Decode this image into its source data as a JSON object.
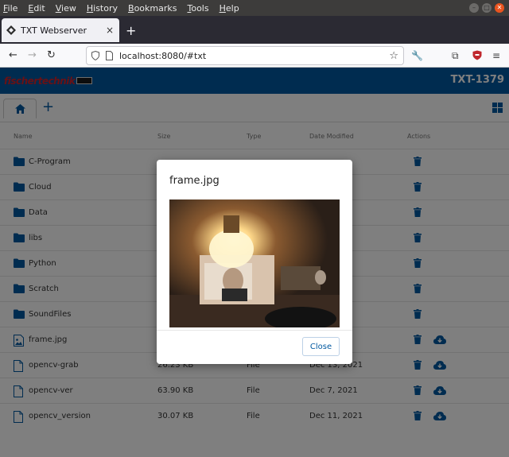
{
  "menu": [
    "File",
    "Edit",
    "View",
    "History",
    "Bookmarks",
    "Tools",
    "Help"
  ],
  "menu_mnemonics": [
    "F",
    "E",
    "V",
    "H",
    "B",
    "T",
    "H"
  ],
  "window_controls": {
    "minimize_icon": "minus-icon",
    "maximize_icon": "square-icon",
    "close_icon": "x-icon"
  },
  "tab": {
    "title": "TXT Webserver",
    "close_label": "×",
    "new_tab_label": "+"
  },
  "nav": {
    "url": "localhost:8080/#txt"
  },
  "app": {
    "logo_text": "fischertechnik",
    "device_name": "TXT-1379",
    "add_label": "+"
  },
  "table": {
    "headers": {
      "name": "Name",
      "size": "Size",
      "type": "Type",
      "date": "Date Modified",
      "actions": "Actions"
    },
    "rows": [
      {
        "name": "C-Program",
        "kind": "folder",
        "size": "",
        "type": "",
        "date": "",
        "download": false
      },
      {
        "name": "Cloud",
        "kind": "folder",
        "size": "",
        "type": "",
        "date": "",
        "download": false
      },
      {
        "name": "Data",
        "kind": "folder",
        "size": "",
        "type": "",
        "date": "",
        "download": false
      },
      {
        "name": "libs",
        "kind": "folder",
        "size": "",
        "type": "",
        "date": "",
        "download": false
      },
      {
        "name": "Python",
        "kind": "folder",
        "size": "",
        "type": "",
        "date": "",
        "download": false
      },
      {
        "name": "Scratch",
        "kind": "folder",
        "size": "",
        "type": "",
        "date": "",
        "download": false
      },
      {
        "name": "SoundFiles",
        "kind": "folder",
        "size": "",
        "type": "",
        "date": "",
        "download": false
      },
      {
        "name": "frame.jpg",
        "kind": "image",
        "size": "",
        "type": "",
        "date": "",
        "download": true
      },
      {
        "name": "opencv-grab",
        "kind": "file",
        "size": "26.23 KB",
        "type": "File",
        "date": "Dec 13, 2021",
        "download": true
      },
      {
        "name": "opencv-ver",
        "kind": "file",
        "size": "63.90 KB",
        "type": "File",
        "date": "Dec 7, 2021",
        "download": true
      },
      {
        "name": "opencv_version",
        "kind": "file",
        "size": "30.07 KB",
        "type": "File",
        "date": "Dec 11, 2021",
        "download": true
      }
    ]
  },
  "modal": {
    "title": "frame.jpg",
    "close_label": "Close"
  },
  "colors": {
    "brand_blue": "#0058a0",
    "logo_red": "#d2232a"
  }
}
